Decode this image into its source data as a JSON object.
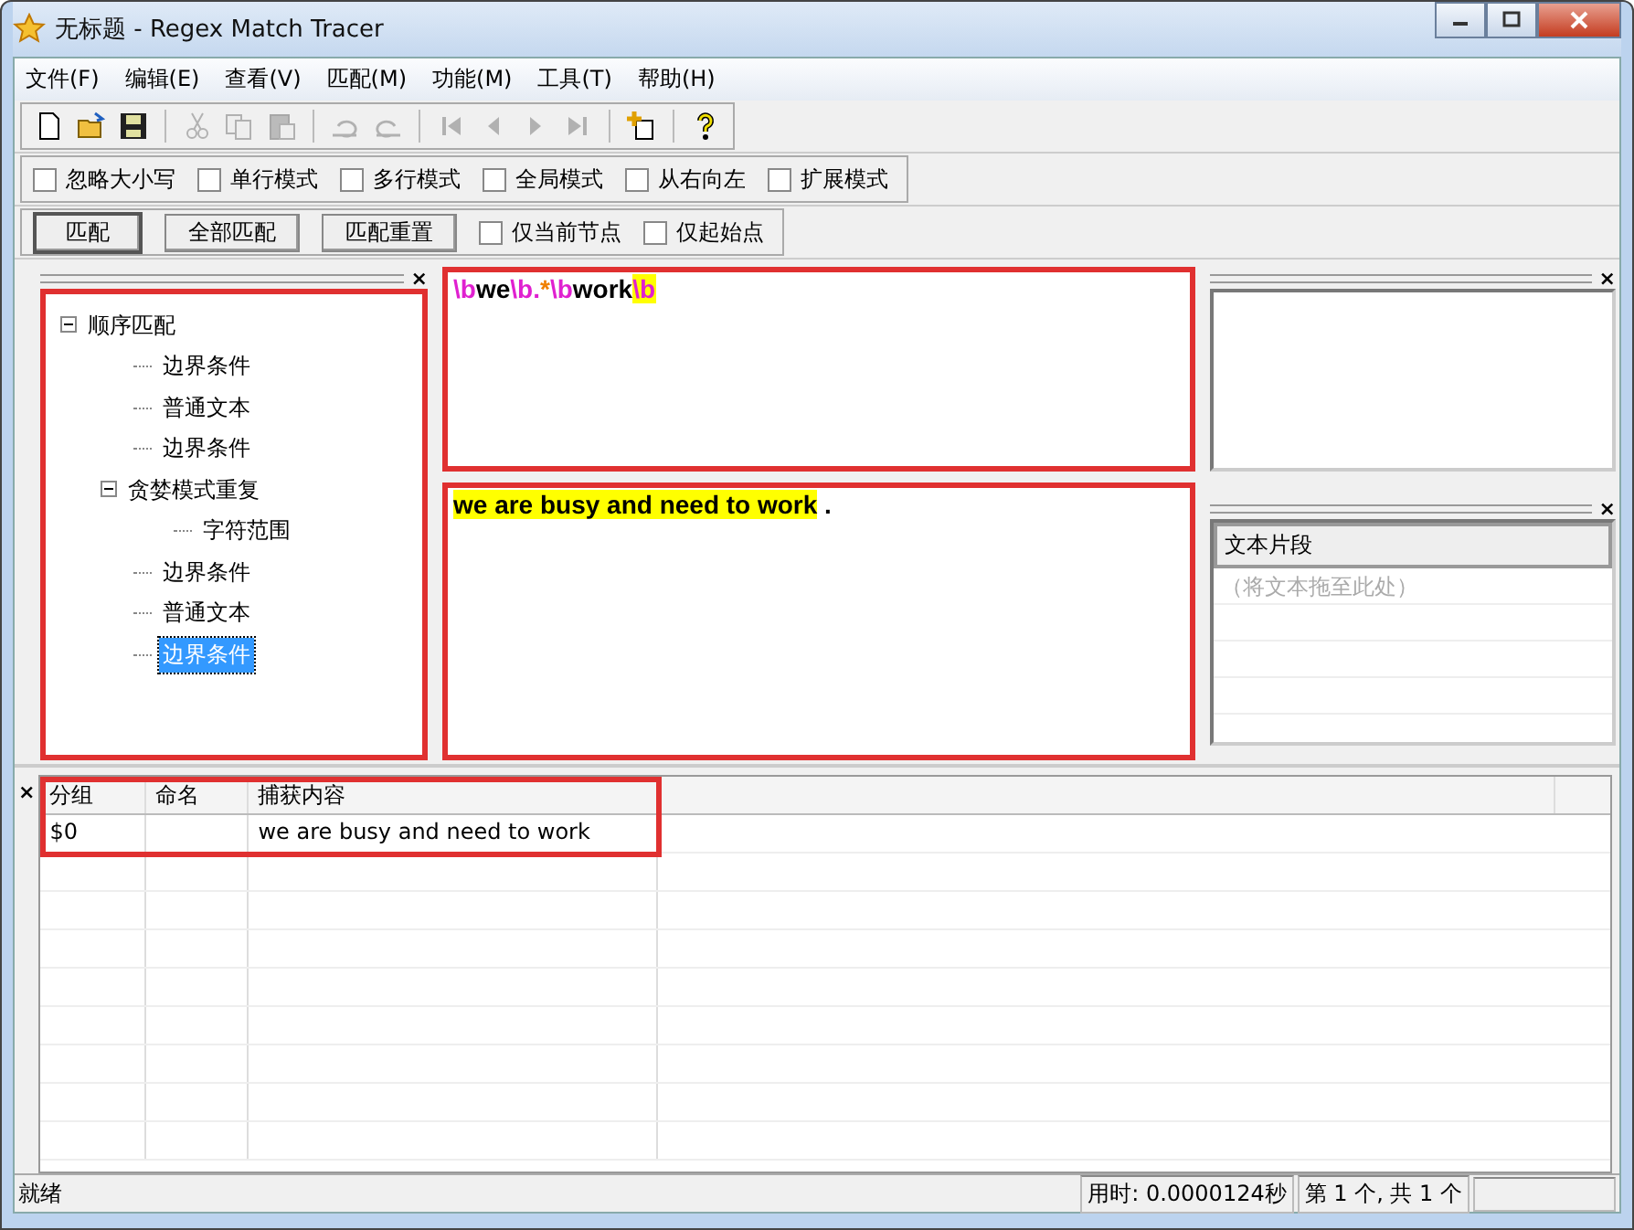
{
  "window": {
    "title": "无标题 - Regex Match Tracer"
  },
  "menu": [
    "文件(F)",
    "编辑(E)",
    "查看(V)",
    "匹配(M)",
    "功能(M)",
    "工具(T)",
    "帮助(H)"
  ],
  "toolbar": [
    {
      "kind": "new",
      "disabled": false
    },
    {
      "kind": "open",
      "disabled": false
    },
    {
      "kind": "save",
      "disabled": false
    },
    {
      "kind": "sep"
    },
    {
      "kind": "cut",
      "disabled": true
    },
    {
      "kind": "copy",
      "disabled": true
    },
    {
      "kind": "paste",
      "disabled": true
    },
    {
      "kind": "sep"
    },
    {
      "kind": "undo",
      "disabled": true
    },
    {
      "kind": "redo",
      "disabled": true
    },
    {
      "kind": "sep"
    },
    {
      "kind": "first",
      "disabled": true
    },
    {
      "kind": "prev",
      "disabled": true
    },
    {
      "kind": "next",
      "disabled": true
    },
    {
      "kind": "last",
      "disabled": true
    },
    {
      "kind": "sep"
    },
    {
      "kind": "add",
      "disabled": false
    },
    {
      "kind": "sep"
    },
    {
      "kind": "help",
      "disabled": false
    }
  ],
  "options": [
    {
      "label": "忽略大小写",
      "checked": false
    },
    {
      "label": "单行模式",
      "checked": false
    },
    {
      "label": "多行模式",
      "checked": false
    },
    {
      "label": "全局模式",
      "checked": false
    },
    {
      "label": "从右向左",
      "checked": false
    },
    {
      "label": "扩展模式",
      "checked": false
    }
  ],
  "actions": {
    "buttons": [
      {
        "label": "匹配",
        "default": true
      },
      {
        "label": "全部匹配",
        "default": false
      },
      {
        "label": "匹配重置",
        "default": false
      }
    ],
    "options": [
      {
        "label": "仅当前节点",
        "checked": false
      },
      {
        "label": "仅起始点",
        "checked": false
      }
    ]
  },
  "tree_panel": {
    "close": "×",
    "outlined": true,
    "items": [
      {
        "label": "顺序匹配",
        "selected": false,
        "expanded": true,
        "children": [
          {
            "label": "边界条件",
            "selected": false
          },
          {
            "label": "普通文本",
            "selected": false
          },
          {
            "label": "边界条件",
            "selected": false
          },
          {
            "label": "贪婪模式重复",
            "selected": false,
            "expanded": true,
            "children": [
              {
                "label": "字符范围",
                "selected": false
              }
            ]
          },
          {
            "label": "边界条件",
            "selected": false
          },
          {
            "label": "普通文本",
            "selected": false
          },
          {
            "label": "边界条件",
            "selected": true
          }
        ]
      }
    ]
  },
  "regex_editor": {
    "outlined": true,
    "tokens": [
      {
        "text": "\\b",
        "kind": "escape",
        "highlighted": false
      },
      {
        "text": "we",
        "kind": "literal",
        "highlighted": false
      },
      {
        "text": "\\b.",
        "kind": "escape",
        "highlighted": false
      },
      {
        "text": "*",
        "kind": "quantifier",
        "highlighted": false
      },
      {
        "text": "\\b",
        "kind": "escape",
        "highlighted": false
      },
      {
        "text": "work",
        "kind": "literal",
        "highlighted": false
      },
      {
        "text": "\\b",
        "kind": "escape",
        "highlighted": true
      }
    ]
  },
  "text_editor": {
    "outlined": true,
    "segments": [
      {
        "text": "we are busy and need to work",
        "highlighted": true
      },
      {
        "text": " .",
        "highlighted": false
      }
    ]
  },
  "side_panel_top": {
    "close": "×"
  },
  "snippets_panel": {
    "close": "×",
    "header": "文本片段",
    "placeholder": "（将文本拖至此处）"
  },
  "results": {
    "close": "×",
    "columns": [
      "分组",
      "命名",
      "捕获内容"
    ],
    "rows": [
      [
        "$0",
        "",
        "we are busy and need to work"
      ]
    ],
    "outlined": true
  },
  "status_bar": [
    "就绪",
    "用时: 0.0000124秒",
    "第 1 个, 共 1 个"
  ]
}
